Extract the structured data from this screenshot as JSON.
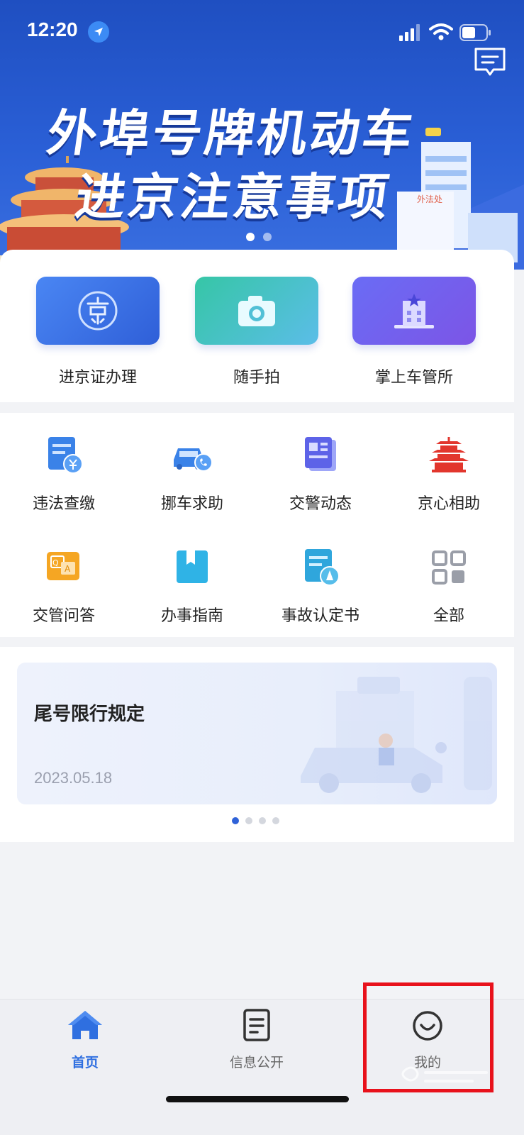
{
  "status_bar": {
    "time": "12:20"
  },
  "banner": {
    "line1": "外埠号牌机动车",
    "line2": "进京注意事项",
    "building_sign": "外法处",
    "slide_count": 2,
    "active_slide": 0
  },
  "services": [
    {
      "label": "进京证办理",
      "icon": "jing-badge-icon"
    },
    {
      "label": "随手拍",
      "icon": "camera-icon"
    },
    {
      "label": "掌上车管所",
      "icon": "building-icon"
    }
  ],
  "grid": [
    {
      "label": "违法查缴",
      "icon": "fine-bill-icon"
    },
    {
      "label": "挪车求助",
      "icon": "car-phone-icon"
    },
    {
      "label": "交警动态",
      "icon": "news-icon"
    },
    {
      "label": "京心相助",
      "icon": "temple-icon"
    },
    {
      "label": "交管问答",
      "icon": "qa-icon"
    },
    {
      "label": "办事指南",
      "icon": "guide-book-icon"
    },
    {
      "label": "事故认定书",
      "icon": "accident-doc-icon"
    },
    {
      "label": "全部",
      "icon": "all-grid-icon"
    }
  ],
  "notice": {
    "title": "尾号限行规定",
    "date": "2023.05.18",
    "slide_count": 4,
    "active_slide": 0
  },
  "tabbar": {
    "home": "首页",
    "info": "信息公开",
    "mine": "我的"
  },
  "colors": {
    "brand_blue": "#2f6fe0",
    "highlight_red": "#e8111b"
  }
}
